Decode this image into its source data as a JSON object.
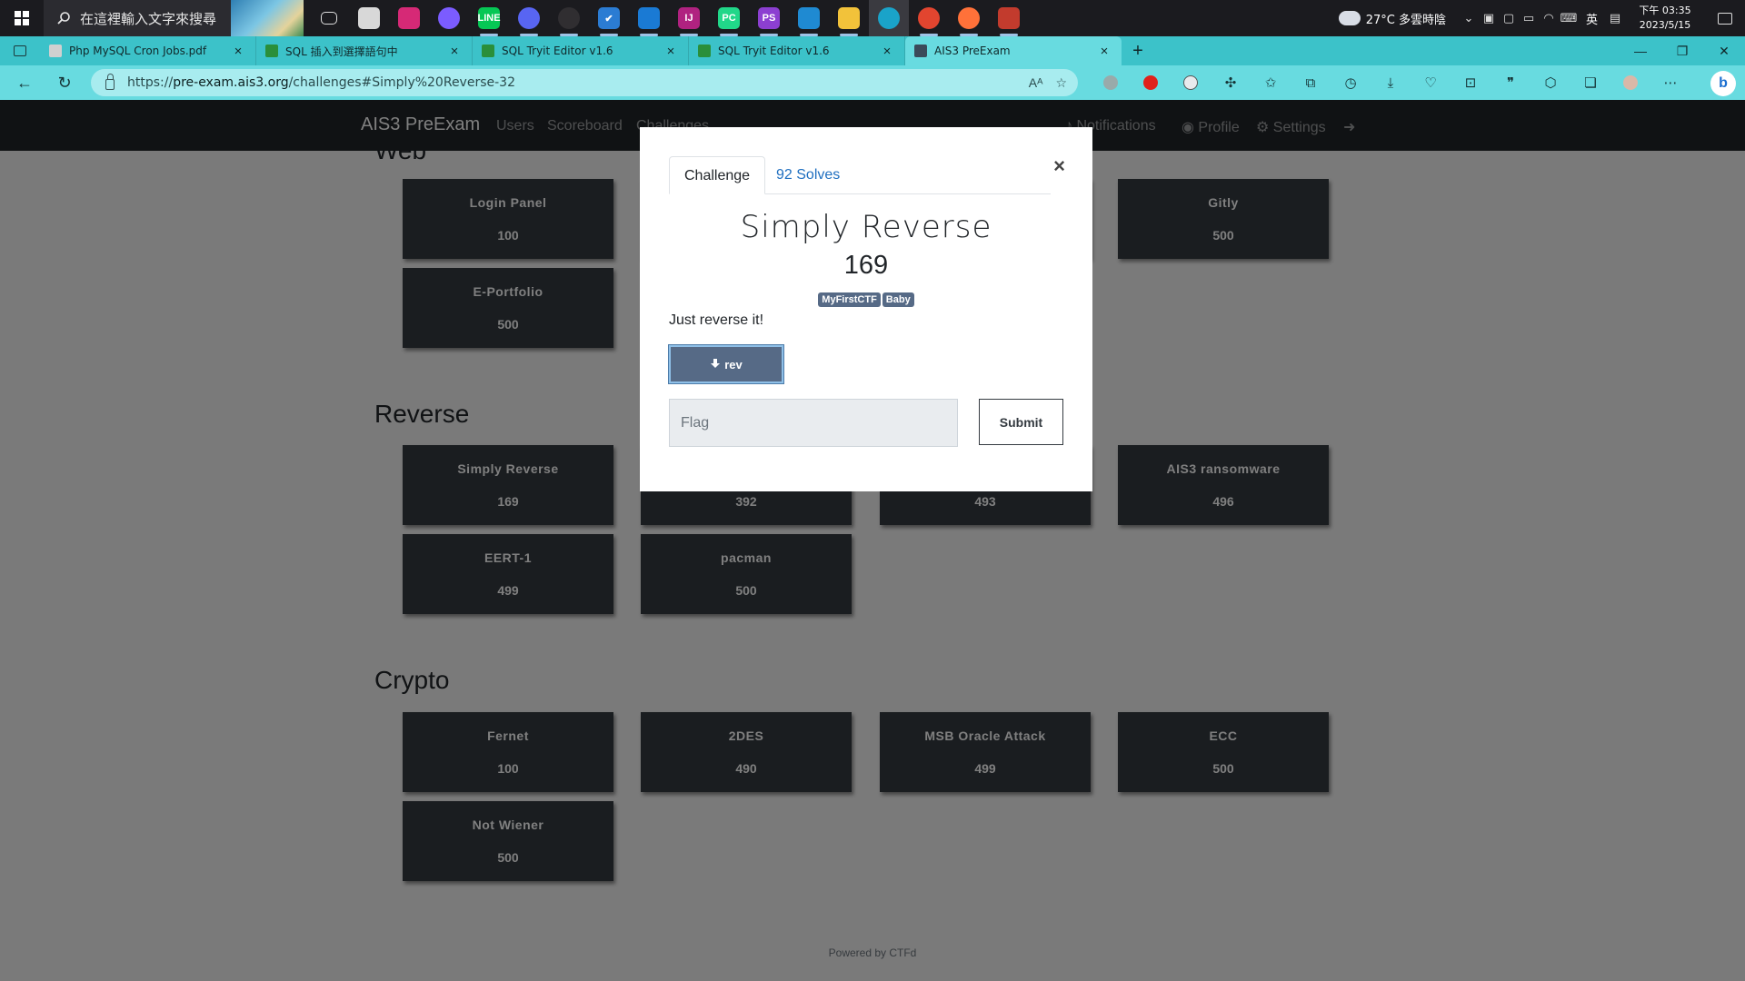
{
  "taskbar": {
    "search_placeholder": "在這裡輸入文字來搜尋",
    "apps": [
      {
        "name": "task-view",
        "label": "",
        "color": "#1b1b1f"
      },
      {
        "name": "notepad",
        "label": "",
        "color": "#d8d8d8"
      },
      {
        "name": "instagram",
        "label": "",
        "color": "#d62976"
      },
      {
        "name": "messenger",
        "label": "",
        "color": "#7b5cff"
      },
      {
        "name": "line",
        "label": "LINE",
        "color": "#06c755"
      },
      {
        "name": "discord",
        "label": "",
        "color": "#5865f2"
      },
      {
        "name": "obs",
        "label": "",
        "color": "#302e31"
      },
      {
        "name": "todo",
        "label": "✔",
        "color": "#2b7cd3"
      },
      {
        "name": "mail",
        "label": "",
        "color": "#1a7ad4"
      },
      {
        "name": "intellij",
        "label": "IJ",
        "color": "#b02280"
      },
      {
        "name": "pycharm",
        "label": "PC",
        "color": "#21d789"
      },
      {
        "name": "phpstorm",
        "label": "PS",
        "color": "#8c3fd1"
      },
      {
        "name": "vscode",
        "label": "",
        "color": "#1f8ad2"
      },
      {
        "name": "file-explorer",
        "label": "",
        "color": "#f2c23a"
      },
      {
        "name": "edge",
        "label": "",
        "color": "#1aa3c9"
      },
      {
        "name": "chrome",
        "label": "",
        "color": "#e2452f"
      },
      {
        "name": "firefox",
        "label": "",
        "color": "#ff7139"
      },
      {
        "name": "git-tool",
        "label": "",
        "color": "#c23b2d"
      }
    ],
    "weather": "27°C  多雲時陰",
    "ime": "英",
    "time": "下午 03:35",
    "date": "2023/5/15"
  },
  "browser": {
    "tabs": [
      {
        "title": "Php MySQL Cron Jobs.pdf",
        "fav_color": "#d0d0d0"
      },
      {
        "title": "SQL 插入到選擇語句中",
        "fav_color": "#2a8f3a"
      },
      {
        "title": "SQL Tryit Editor v1.6",
        "fav_color": "#2a8f3a"
      },
      {
        "title": "SQL Tryit Editor v1.6",
        "fav_color": "#2a8f3a"
      },
      {
        "title": "AIS3 PreExam",
        "fav_color": "#3b4a5a"
      }
    ],
    "url_prefix": "https://",
    "url_host": "pre-exam.ais3.org",
    "url_path": "/challenges#Simply%20Reverse-32"
  },
  "site": {
    "brand": "AIS3 PreExam",
    "nav_left": [
      "Users",
      "Scoreboard",
      "Challenges"
    ],
    "nav_right": [
      "Notifications",
      "Profile",
      "Settings"
    ],
    "footer": "Powered by CTFd"
  },
  "sections": [
    {
      "title": "Web",
      "challenges": [
        {
          "name": "Login Panel",
          "value": "100"
        },
        {
          "name": "",
          "value": ""
        },
        {
          "name": "",
          "value": ""
        },
        {
          "name": "Gitly",
          "value": "500"
        },
        {
          "name": "E-Portfolio",
          "value": "500"
        }
      ]
    },
    {
      "title": "Reverse",
      "challenges": [
        {
          "name": "Simply Reverse",
          "value": "169"
        },
        {
          "name": "",
          "value": "392"
        },
        {
          "name": "",
          "value": "493"
        },
        {
          "name": "AIS3 ransomware",
          "value": "496"
        },
        {
          "name": "EERT-1",
          "value": "499"
        },
        {
          "name": "pacman",
          "value": "500"
        }
      ]
    },
    {
      "title": "Crypto",
      "challenges": [
        {
          "name": "Fernet",
          "value": "100"
        },
        {
          "name": "2DES",
          "value": "490"
        },
        {
          "name": "MSB Oracle Attack",
          "value": "499"
        },
        {
          "name": "ECC",
          "value": "500"
        },
        {
          "name": "Not Wiener",
          "value": "500"
        }
      ]
    }
  ],
  "modal": {
    "tab_challenge": "Challenge",
    "tab_solves": "92 Solves",
    "title": "Simply Reverse",
    "value": "169",
    "tags": [
      "MyFirstCTF",
      "Baby"
    ],
    "description": "Just reverse it!",
    "file_label": "rev",
    "flag_placeholder": "Flag",
    "submit_label": "Submit"
  },
  "colors": {
    "navbar": "#212529",
    "card": "#343a40",
    "tag": "#566a86",
    "tabstrip": "#3cc2c9",
    "addressbar": "#68dbe0"
  }
}
